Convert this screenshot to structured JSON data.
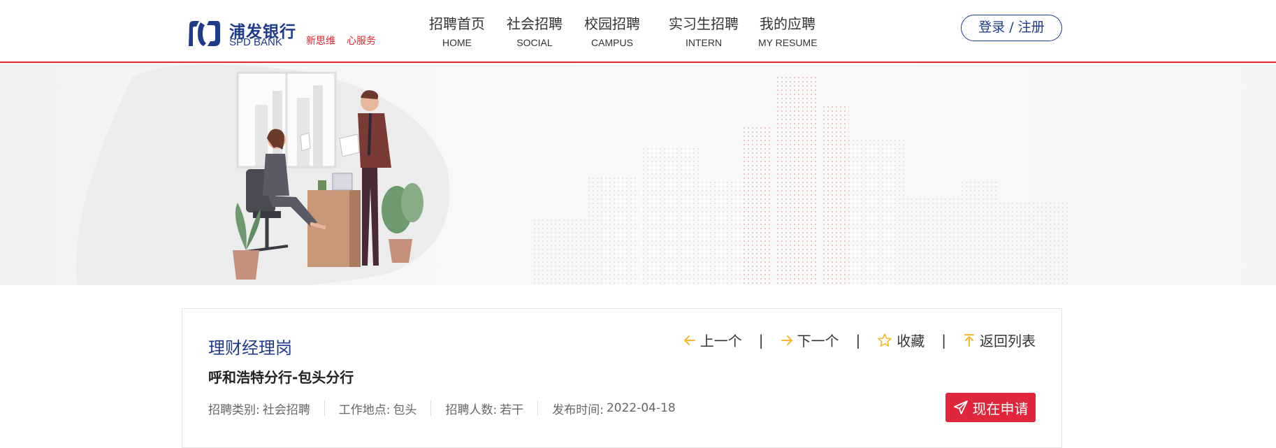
{
  "brand": {
    "name_cn": "浦发银行",
    "name_en": "SPD BANK",
    "slogan": [
      "新思维",
      "心服务"
    ],
    "color_primary": "#1e3a8a",
    "color_accent": "#e0262f"
  },
  "nav": {
    "items": [
      {
        "cn": "招聘首页",
        "en": "HOME"
      },
      {
        "cn": "社会招聘",
        "en": "SOCIAL"
      },
      {
        "cn": "校园招聘",
        "en": "CAMPUS"
      },
      {
        "cn": "实习生招聘",
        "en": "INTERN"
      },
      {
        "cn": "我的应聘",
        "en": "MY RESUME"
      }
    ],
    "login_label": "登录 / 注册"
  },
  "banner": {
    "illustration": "office-meeting-city-skyline"
  },
  "job": {
    "title": "理财经理岗",
    "branch": "呼和浩特分行-包头分行",
    "meta": [
      {
        "label": "招聘类别:",
        "value": "社会招聘"
      },
      {
        "label": "工作地点:",
        "value": "包头"
      },
      {
        "label": "招聘人数:",
        "value": "若干"
      },
      {
        "label": "发布时间:",
        "value": "2022-04-18"
      }
    ],
    "actions": {
      "prev": "上一个",
      "next": "下一个",
      "favorite": "收藏",
      "back": "返回列表",
      "separator": "|"
    },
    "apply_label": "现在申请",
    "icons": {
      "prev": "arrow-left-icon",
      "next": "arrow-right-icon",
      "favorite": "star-icon",
      "back": "arrow-up-icon",
      "apply": "paper-plane-icon"
    },
    "icon_color": "#f5b82e",
    "apply_color": "#e0263a"
  }
}
